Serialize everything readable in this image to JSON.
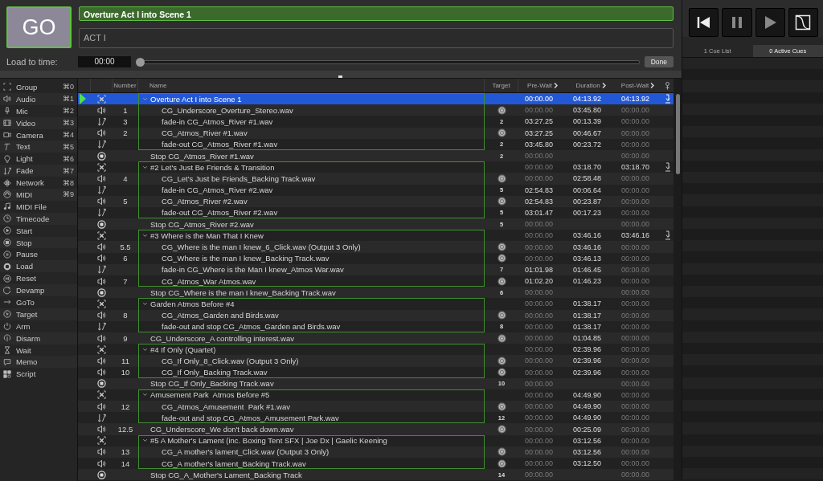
{
  "go_button": {
    "label": "GO"
  },
  "cue_name_field": {
    "value": "Overture Act I into Scene 1"
  },
  "notes_field": {
    "value": "ACT I"
  },
  "load_to_time": {
    "label": "Load to time:",
    "value": "00:00",
    "level": 0,
    "button": "Done"
  },
  "toolbox": [
    {
      "label": "Group",
      "shortcut": "⌘0"
    },
    {
      "label": "Audio",
      "shortcut": "⌘1"
    },
    {
      "label": "Mic",
      "shortcut": "⌘2"
    },
    {
      "label": "Video",
      "shortcut": "⌘3"
    },
    {
      "label": "Camera",
      "shortcut": "⌘4"
    },
    {
      "label": "Text",
      "shortcut": "⌘5"
    },
    {
      "label": "Light",
      "shortcut": "⌘6"
    },
    {
      "label": "Fade",
      "shortcut": "⌘7"
    },
    {
      "label": "Network",
      "shortcut": "⌘8"
    },
    {
      "label": "MIDI",
      "shortcut": "⌘9"
    },
    {
      "label": "MIDI File"
    },
    {
      "label": "Timecode"
    },
    {
      "label": "Start"
    },
    {
      "label": "Stop"
    },
    {
      "label": "Pause"
    },
    {
      "label": "Load"
    },
    {
      "label": "Reset"
    },
    {
      "label": "Devamp"
    },
    {
      "label": "GoTo"
    },
    {
      "label": "Target"
    },
    {
      "label": "Arm"
    },
    {
      "label": "Disarm"
    },
    {
      "label": "Wait"
    },
    {
      "label": "Memo"
    },
    {
      "label": "Script"
    }
  ],
  "cue_table": {
    "columns": [
      "Number",
      "Name",
      "Target",
      "Pre-Wait",
      "Duration",
      "Post-Wait"
    ],
    "cues": [
      {
        "kind": "group",
        "name": "Overture Act I into Scene 1",
        "selected": true,
        "playhead": true,
        "expanded": true,
        "auto_continue": true,
        "pre_wait": {
          "text": "00:00.00",
          "dim": false
        },
        "duration": {
          "text": "04:13.92",
          "dim": false
        },
        "post_wait": {
          "text": "04:13.92",
          "dim": false
        },
        "children": [
          {
            "kind": "audio",
            "number": "1",
            "name": "CG_Underscore_Overture_Stereo.wav",
            "selected": false,
            "playhead": false,
            "pre_wait": {
              "text": "00:00.00",
              "dim": true
            },
            "duration": {
              "text": "03:45.80",
              "dim": false
            },
            "post_wait": {
              "text": "00:00.00",
              "dim": true
            }
          },
          {
            "kind": "fade",
            "number": "3",
            "name": "fade-in CG_Atmos_River #1.wav",
            "target": "2",
            "selected": false,
            "playhead": false,
            "pre_wait": {
              "text": "03:27.25",
              "dim": false
            },
            "duration": {
              "text": "00:13.39",
              "dim": false
            },
            "post_wait": {
              "text": "00:00.00",
              "dim": true
            }
          },
          {
            "kind": "audio",
            "number": "2",
            "name": "CG_Atmos_River #1.wav",
            "selected": false,
            "playhead": false,
            "pre_wait": {
              "text": "03:27.25",
              "dim": false
            },
            "duration": {
              "text": "00:46.67",
              "dim": false
            },
            "post_wait": {
              "text": "00:00.00",
              "dim": true
            }
          },
          {
            "kind": "fade",
            "name": "fade-out CG_Atmos_River #1.wav",
            "target": "2",
            "selected": false,
            "playhead": false,
            "pre_wait": {
              "text": "03:45.80",
              "dim": false
            },
            "duration": {
              "text": "00:23.72",
              "dim": false
            },
            "post_wait": {
              "text": "00:00.00",
              "dim": true
            }
          }
        ]
      },
      {
        "kind": "stop",
        "name": "Stop CG_Atmos_River #1.wav",
        "target": "2",
        "selected": false,
        "playhead": false,
        "pre_wait": {
          "text": "00:00.00",
          "dim": true
        },
        "post_wait": {
          "text": "00:00.00",
          "dim": true
        }
      },
      {
        "kind": "group",
        "name": "#2 Let's Just Be Friends & Transition",
        "selected": false,
        "playhead": false,
        "expanded": true,
        "auto_continue": true,
        "pre_wait": {
          "text": "00:00.00",
          "dim": true
        },
        "duration": {
          "text": "03:18.70",
          "dim": false
        },
        "post_wait": {
          "text": "03:18.70",
          "dim": false
        },
        "children": [
          {
            "kind": "audio",
            "number": "4",
            "name": "CG_Let's Just be Friends_Backing Track.wav",
            "selected": false,
            "playhead": false,
            "pre_wait": {
              "text": "00:00.00",
              "dim": true
            },
            "duration": {
              "text": "02:58.48",
              "dim": false
            },
            "post_wait": {
              "text": "00:00.00",
              "dim": true
            }
          },
          {
            "kind": "fade",
            "name": "fade-in CG_Atmos_River #2.wav",
            "target": "5",
            "selected": false,
            "playhead": false,
            "pre_wait": {
              "text": "02:54.83",
              "dim": false
            },
            "duration": {
              "text": "00:06.64",
              "dim": false
            },
            "post_wait": {
              "text": "00:00.00",
              "dim": true
            }
          },
          {
            "kind": "audio",
            "number": "5",
            "name": "CG_Atmos_River #2.wav",
            "selected": false,
            "playhead": false,
            "pre_wait": {
              "text": "02:54.83",
              "dim": false
            },
            "duration": {
              "text": "00:23.87",
              "dim": false
            },
            "post_wait": {
              "text": "00:00.00",
              "dim": true
            }
          },
          {
            "kind": "fade",
            "name": "fade-out CG_Atmos_River #2.wav",
            "target": "5",
            "selected": false,
            "playhead": false,
            "pre_wait": {
              "text": "03:01.47",
              "dim": false
            },
            "duration": {
              "text": "00:17.23",
              "dim": false
            },
            "post_wait": {
              "text": "00:00.00",
              "dim": true
            }
          }
        ]
      },
      {
        "kind": "stop",
        "name": "Stop CG_Atmos_River #2.wav",
        "target": "5",
        "selected": false,
        "playhead": false,
        "pre_wait": {
          "text": "00:00.00",
          "dim": true
        },
        "post_wait": {
          "text": "00:00.00",
          "dim": true
        }
      },
      {
        "kind": "group",
        "name": "#3 Where is the Man That I Knew",
        "selected": false,
        "playhead": false,
        "expanded": true,
        "auto_continue": true,
        "pre_wait": {
          "text": "00:00.00",
          "dim": true
        },
        "duration": {
          "text": "03:46.16",
          "dim": false
        },
        "post_wait": {
          "text": "03:46.16",
          "dim": false
        },
        "children": [
          {
            "kind": "audio",
            "number": "5.5",
            "name": "CG_Where is the man I knew_6_Click.wav (Output 3 Only)",
            "selected": false,
            "playhead": false,
            "pre_wait": {
              "text": "00:00.00",
              "dim": true
            },
            "duration": {
              "text": "03:46.16",
              "dim": false
            },
            "post_wait": {
              "text": "00:00.00",
              "dim": true
            }
          },
          {
            "kind": "audio",
            "number": "6",
            "name": "CG_Where is the man I knew_Backing Track.wav",
            "selected": false,
            "playhead": false,
            "pre_wait": {
              "text": "00:00.00",
              "dim": true
            },
            "duration": {
              "text": "03:46.13",
              "dim": false
            },
            "post_wait": {
              "text": "00:00.00",
              "dim": true
            }
          },
          {
            "kind": "fade",
            "name": "fade-in CG_Where is the Man I knew_Atmos War.wav",
            "target": "7",
            "selected": false,
            "playhead": false,
            "pre_wait": {
              "text": "01:01.98",
              "dim": false
            },
            "duration": {
              "text": "01:46.45",
              "dim": false
            },
            "post_wait": {
              "text": "00:00.00",
              "dim": true
            }
          },
          {
            "kind": "audio",
            "number": "7",
            "name": "CG_Atmos_War Atmos.wav",
            "selected": false,
            "playhead": false,
            "pre_wait": {
              "text": "01:02.20",
              "dim": false
            },
            "duration": {
              "text": "01:46.23",
              "dim": false
            },
            "post_wait": {
              "text": "00:00.00",
              "dim": true
            }
          }
        ]
      },
      {
        "kind": "stop",
        "name": "Stop CG_Where is the man I knew_Backing Track.wav",
        "target": "6",
        "selected": false,
        "playhead": false,
        "pre_wait": {
          "text": "00:00.00",
          "dim": true
        },
        "post_wait": {
          "text": "00:00.00",
          "dim": true
        }
      },
      {
        "kind": "group",
        "name": "Garden Atmos Before #4",
        "selected": false,
        "playhead": false,
        "expanded": true,
        "auto_continue": false,
        "pre_wait": {
          "text": "00:00.00",
          "dim": true
        },
        "duration": {
          "text": "01:38.17",
          "dim": false
        },
        "post_wait": {
          "text": "00:00.00",
          "dim": true
        },
        "children": [
          {
            "kind": "audio",
            "number": "8",
            "name": "CG_Atmos_Garden and Birds.wav",
            "selected": false,
            "playhead": false,
            "pre_wait": {
              "text": "00:00.00",
              "dim": true
            },
            "duration": {
              "text": "01:38.17",
              "dim": false
            },
            "post_wait": {
              "text": "00:00.00",
              "dim": true
            }
          },
          {
            "kind": "fade",
            "name": "fade-out and stop CG_Atmos_Garden and Birds.wav",
            "target": "8",
            "selected": false,
            "playhead": false,
            "pre_wait": {
              "text": "00:00.00",
              "dim": true
            },
            "duration": {
              "text": "01:38.17",
              "dim": false
            },
            "post_wait": {
              "text": "00:00.00",
              "dim": true
            }
          }
        ]
      },
      {
        "kind": "audio",
        "number": "9",
        "name": "CG_Underscore_A controlling interest.wav",
        "selected": false,
        "playhead": false,
        "pre_wait": {
          "text": "00:00.00",
          "dim": true
        },
        "duration": {
          "text": "01:04.85",
          "dim": false
        },
        "post_wait": {
          "text": "00:00.00",
          "dim": true
        }
      },
      {
        "kind": "group",
        "name": "#4 If Only (Quartet)",
        "selected": false,
        "playhead": false,
        "expanded": true,
        "auto_continue": false,
        "pre_wait": {
          "text": "00:00.00",
          "dim": true
        },
        "duration": {
          "text": "02:39.96",
          "dim": false
        },
        "post_wait": {
          "text": "00:00.00",
          "dim": true
        },
        "children": [
          {
            "kind": "audio",
            "number": "11",
            "name": "CG_If Only_8_Click.wav (Output 3 Only)",
            "selected": false,
            "playhead": false,
            "pre_wait": {
              "text": "00:00.00",
              "dim": true
            },
            "duration": {
              "text": "02:39.96",
              "dim": false
            },
            "post_wait": {
              "text": "00:00.00",
              "dim": true
            }
          },
          {
            "kind": "audio",
            "number": "10",
            "name": "CG_If Only_Backing Track.wav",
            "selected": false,
            "playhead": false,
            "pre_wait": {
              "text": "00:00.00",
              "dim": true
            },
            "duration": {
              "text": "02:39.96",
              "dim": false
            },
            "post_wait": {
              "text": "00:00.00",
              "dim": true
            }
          }
        ]
      },
      {
        "kind": "stop",
        "name": "Stop CG_If Only_Backing Track.wav",
        "target": "10",
        "selected": false,
        "playhead": false,
        "pre_wait": {
          "text": "00:00.00",
          "dim": true
        },
        "post_wait": {
          "text": "00:00.00",
          "dim": true
        }
      },
      {
        "kind": "group",
        "name": "Amusement Park  Atmos Before #5",
        "selected": false,
        "playhead": false,
        "expanded": true,
        "auto_continue": false,
        "pre_wait": {
          "text": "00:00.00",
          "dim": true
        },
        "duration": {
          "text": "04:49.90",
          "dim": false
        },
        "post_wait": {
          "text": "00:00.00",
          "dim": true
        },
        "children": [
          {
            "kind": "audio",
            "number": "12",
            "name": "CG_Atmos_Amusement  Park #1.wav",
            "selected": false,
            "playhead": false,
            "pre_wait": {
              "text": "00:00.00",
              "dim": true
            },
            "duration": {
              "text": "04:49.90",
              "dim": false
            },
            "post_wait": {
              "text": "00:00.00",
              "dim": true
            }
          },
          {
            "kind": "fade",
            "name": "fade-out and stop CG_Atmos_Amusement Park.wav",
            "target": "12",
            "selected": false,
            "playhead": false,
            "pre_wait": {
              "text": "00:00.00",
              "dim": true
            },
            "duration": {
              "text": "04:49.90",
              "dim": false
            },
            "post_wait": {
              "text": "00:00.00",
              "dim": true
            }
          }
        ]
      },
      {
        "kind": "audio",
        "number": "12.5",
        "name": "CG_Underscore_We don't back down.wav",
        "selected": false,
        "playhead": false,
        "pre_wait": {
          "text": "00:00.00",
          "dim": true
        },
        "duration": {
          "text": "00:25.09",
          "dim": false
        },
        "post_wait": {
          "text": "00:00.00",
          "dim": true
        }
      },
      {
        "kind": "group",
        "name": "#5 A Mother's Lament (inc. Boxing Tent SFX | Joe Dx | Gaelic Keening",
        "selected": false,
        "playhead": false,
        "expanded": true,
        "auto_continue": false,
        "pre_wait": {
          "text": "00:00.00",
          "dim": true
        },
        "duration": {
          "text": "03:12.56",
          "dim": false
        },
        "post_wait": {
          "text": "00:00.00",
          "dim": true
        },
        "children": [
          {
            "kind": "audio",
            "number": "13",
            "name": "CG_A mother's lament_Click.wav (Output 3 Only)",
            "selected": false,
            "playhead": false,
            "pre_wait": {
              "text": "00:00.00",
              "dim": true
            },
            "duration": {
              "text": "03:12.56",
              "dim": false
            },
            "post_wait": {
              "text": "00:00.00",
              "dim": true
            }
          },
          {
            "kind": "audio",
            "number": "14",
            "name": "CG_A mother's lament_Backing Track.wav",
            "selected": false,
            "playhead": false,
            "pre_wait": {
              "text": "00:00.00",
              "dim": true
            },
            "duration": {
              "text": "03:12.50",
              "dim": false
            },
            "post_wait": {
              "text": "00:00.00",
              "dim": true
            }
          }
        ]
      },
      {
        "kind": "stop",
        "name": "Stop CG_A_Mother's Lament_Backing Track",
        "target": "14",
        "selected": false,
        "playhead": false,
        "pre_wait": {
          "text": "00:00.00",
          "dim": true
        },
        "post_wait": {
          "text": "00:00.00",
          "dim": true
        }
      }
    ]
  },
  "tabs": [
    {
      "label": "1 Cue List",
      "selected": false
    },
    {
      "label": "0 Active Cues",
      "selected": true
    }
  ]
}
